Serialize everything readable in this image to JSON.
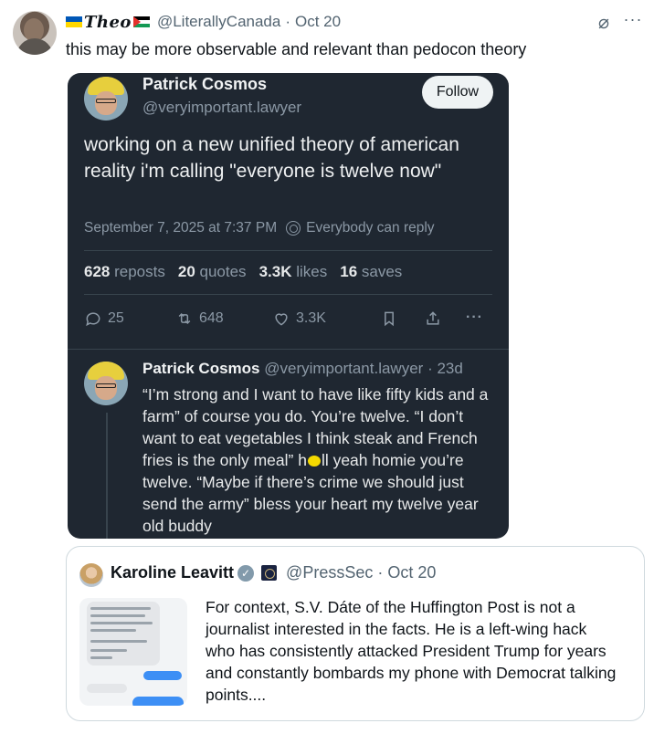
{
  "outer_tweet": {
    "display_name": "Theo",
    "handle": "@LiterallyCanada",
    "separator": "·",
    "date": "Oct 20",
    "text": "this may be more observable and relevant than pedocon theory",
    "icons": [
      "grok-icon",
      "more-icon"
    ]
  },
  "embedded_post": {
    "author_name": "Patrick Cosmos",
    "author_handle": "@veryimportant.lawyer",
    "follow_label": "Follow",
    "body": "working on a new unified theory of american reality i'm calling \"everyone is twelve now\"",
    "timestamp": "September 7, 2025 at 7:37 PM",
    "reply_setting": "Everybody can reply",
    "stats": [
      {
        "count": "628",
        "label": "reposts"
      },
      {
        "count": "20",
        "label": "quotes"
      },
      {
        "count": "3.3K",
        "label": "likes"
      },
      {
        "count": "16",
        "label": "saves"
      }
    ],
    "actions": {
      "replies": "25",
      "reposts": "648",
      "likes": "3.3K"
    },
    "reply": {
      "author_name": "Patrick Cosmos",
      "author_handle": "@veryimportant.lawyer",
      "age": "· 23d",
      "body_part1": "“I’m strong and I want to have like fifty kids and a farm” of course you do. You’re twelve. “I don’t want to eat vegetables I think steak and French fries is the only meal” h",
      "body_part2": "ll yeah homie you’re twelve. “Maybe if there’s crime we should just send the army” bless your heart my twelve year old buddy"
    }
  },
  "quoted_tweet": {
    "author_name": "Karoline Leavitt",
    "handle": "@PressSec",
    "separator": "·",
    "date": "Oct 20",
    "text": "For context, S.V. Dáte of the Huffington Post is not a journalist interested in the facts. He is a left-wing hack who has consistently attacked President Trump for years and constantly bombards my phone with Democrat talking points...."
  }
}
